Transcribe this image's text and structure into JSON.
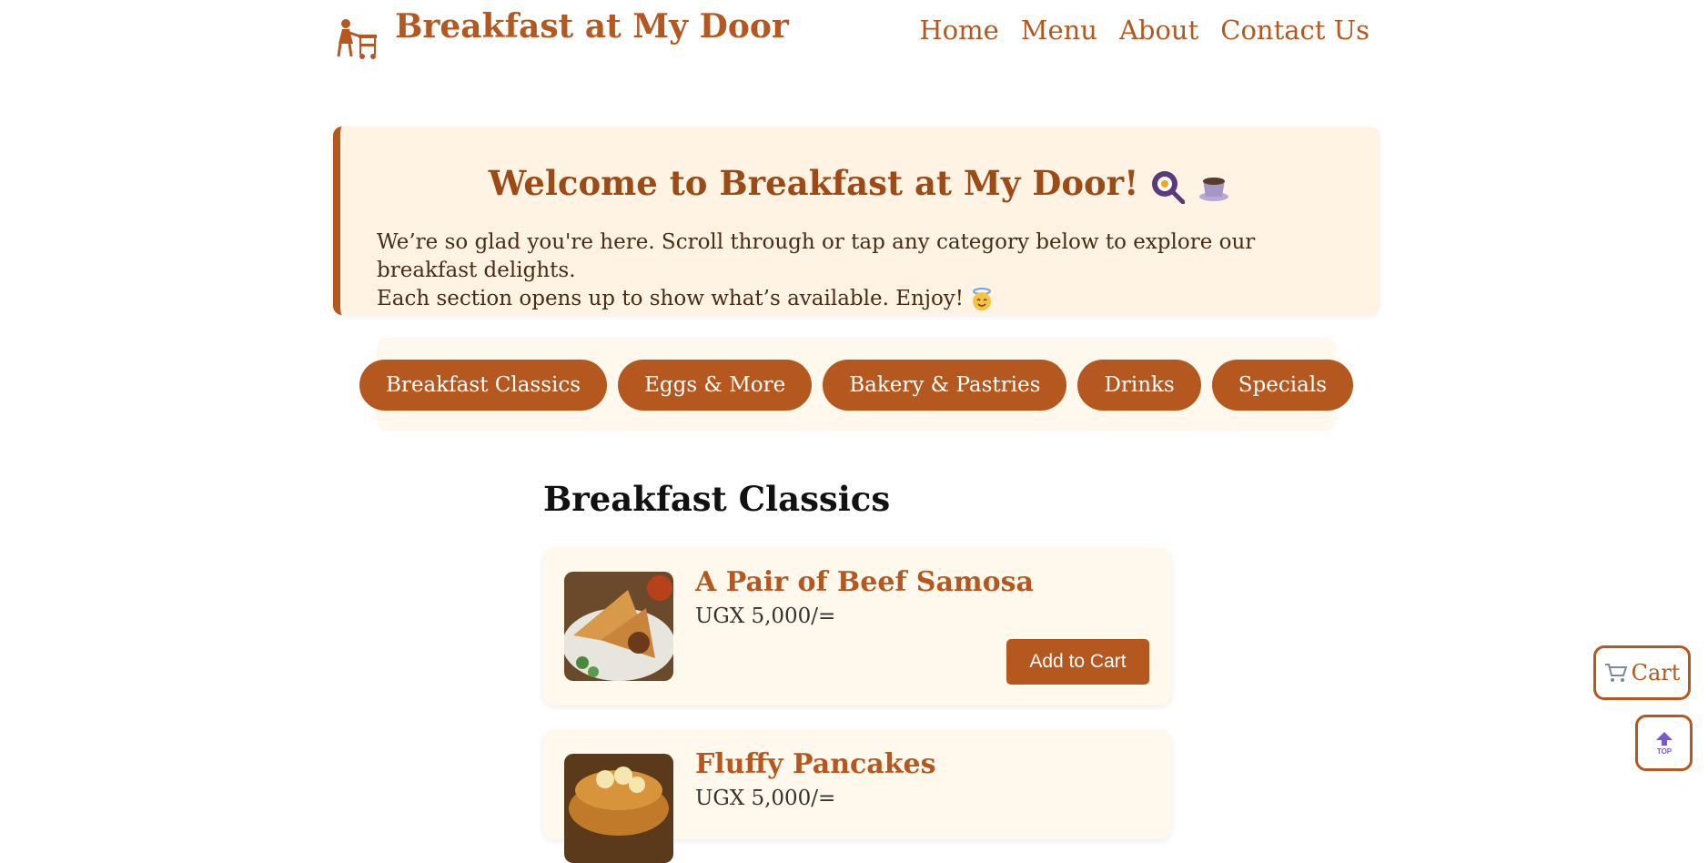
{
  "header": {
    "site_title": "Breakfast at My Door",
    "logo_icon": "waiter-with-cart-icon",
    "nav": [
      "Home",
      "Menu",
      "About",
      "Contact Us"
    ]
  },
  "welcome": {
    "title": "Welcome to Breakfast at My Door!",
    "line1": "We’re so glad you're here. Scroll through or tap any category below to explore our breakfast delights.",
    "line2": "Each section opens up to show what’s available. Enjoy!",
    "title_emojis": [
      "🍳",
      "☕"
    ],
    "text_emoji": "😇"
  },
  "categories": [
    "Breakfast Classics",
    "Eggs & More",
    "Bakery & Pastries",
    "Drinks",
    "Specials"
  ],
  "section": {
    "title": "Breakfast Classics",
    "items": [
      {
        "name": "A Pair of Beef Samosa",
        "price": "UGX 5,000/=",
        "button": "Add to Cart"
      },
      {
        "name": "Fluffy Pancakes",
        "price": "UGX 5,000/="
      }
    ]
  },
  "cart": {
    "label": "Cart",
    "icon": "shopping-cart-icon"
  },
  "back_to_top": {
    "label": "TOP",
    "icon": "up-arrow-icon"
  },
  "colors": {
    "brand": "#b5581f",
    "welcome_bg": "#fff3e4",
    "card_bg": "#fff8ec"
  }
}
